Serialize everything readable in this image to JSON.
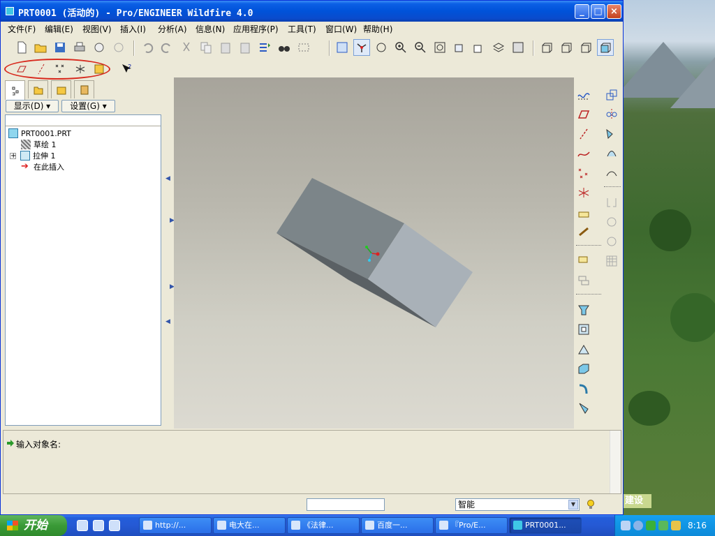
{
  "window": {
    "title": "PRT0001 (活动的) - Pro/ENGINEER Wildfire 4.0"
  },
  "menu": [
    "文件(F)",
    "编辑(E)",
    "视图(V)",
    "插入(I)",
    "分析(A)",
    "信息(N)",
    "应用程序(P)",
    "工具(T)",
    "窗口(W)",
    "帮助(H)"
  ],
  "nav": {
    "show_label": "显示(D) ▾",
    "settings_label": "设置(G) ▾"
  },
  "tree": {
    "items": [
      "PRT0001.PRT",
      "草绘 1",
      "拉伸 1",
      "在此插入"
    ]
  },
  "message": {
    "prompt": "输入对象名:"
  },
  "status": {
    "filter_value": "智能"
  },
  "taskbar": {
    "start_label": "开始",
    "tasks": [
      "http://...",
      "电大在...",
      "《法律...",
      "百度一...",
      "『Pro/E...",
      "PRT0001..."
    ],
    "clock": "8:16"
  },
  "desktop": {
    "tag": "建设"
  }
}
